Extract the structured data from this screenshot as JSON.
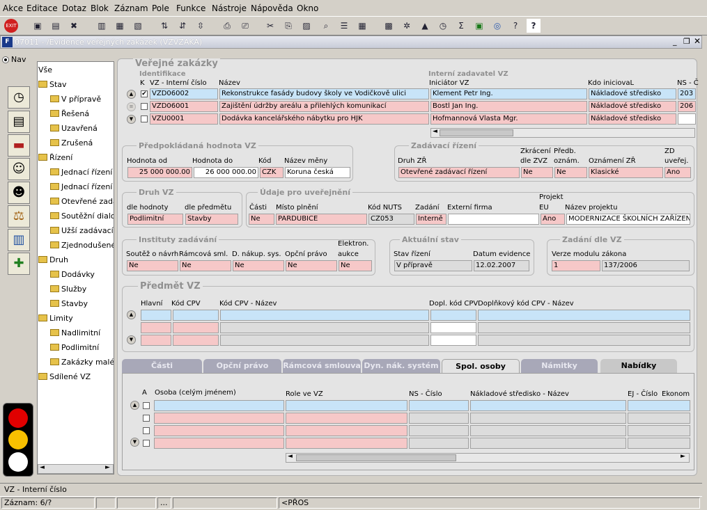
{
  "menu": [
    "Akce",
    "Editace",
    "Dotaz",
    "Blok",
    "Záznam",
    "Pole",
    "Funkce",
    "Nástroje",
    "Nápověda",
    "Okno"
  ],
  "window": {
    "title": "07011 - /Evidence veřejných zakázek (VZVZAKA)"
  },
  "nav": {
    "radio": "Nav"
  },
  "tree": {
    "root": "Vše",
    "items": [
      {
        "l": "Stav",
        "d": 0
      },
      {
        "l": "V přípravě",
        "d": 1
      },
      {
        "l": "Řešená",
        "d": 1
      },
      {
        "l": "Uzavřená",
        "d": 1
      },
      {
        "l": "Zrušená",
        "d": 1
      },
      {
        "l": "Řízení",
        "d": 0
      },
      {
        "l": "Jednací řízení b",
        "d": 1
      },
      {
        "l": "Jednací řízení s",
        "d": 1
      },
      {
        "l": "Otevřené zadá",
        "d": 1
      },
      {
        "l": "Soutěžní dialog",
        "d": 1
      },
      {
        "l": "Užší zadávací í",
        "d": 1
      },
      {
        "l": "Zjednodušené",
        "d": 1
      },
      {
        "l": "Druh",
        "d": 0
      },
      {
        "l": "Dodávky",
        "d": 1
      },
      {
        "l": "Služby",
        "d": 1
      },
      {
        "l": "Stavby",
        "d": 1
      },
      {
        "l": "Limity",
        "d": 0
      },
      {
        "l": "Nadlimitní",
        "d": 1
      },
      {
        "l": "Podlimitní",
        "d": 1
      },
      {
        "l": "Zakázky maléh",
        "d": 1
      },
      {
        "l": "Sdílené VZ",
        "d": 0
      }
    ]
  },
  "vz": {
    "title": "Veřejné zakázky",
    "sub1": "Identifikace",
    "sub2": "Interní zadavatel VZ",
    "hdr": {
      "k": "K",
      "cislo": "VZ - Interní číslo",
      "nazev": "Název",
      "inic": "Iniciátor VZ",
      "kdo": "Kdo iniciovaL",
      "ns": "NS - Č"
    },
    "rows": [
      {
        "checked": "✔",
        "cislo": "VZD06002",
        "nazev": "Rekonstrukce fasády budovy školy ve Vodičkově ulici",
        "inic": "Klement Petr Ing.",
        "kdo": "Nákladové středisko",
        "ns": "203"
      },
      {
        "checked": "",
        "cislo": "VZD06001",
        "nazev": "Zajištění údržby areálu a přilehlých komunikací",
        "inic": "Bostl Jan Ing.",
        "kdo": "Nákladové středisko",
        "ns": "206"
      },
      {
        "checked": "",
        "cislo": "VZU0001",
        "nazev": "Dodávka kancelářského nábytku pro HJK",
        "inic": "Hofmannová Vlasta Mgr.",
        "kdo": "Nákladové středisko",
        "ns": ""
      }
    ]
  },
  "hodnota": {
    "title": "Předpokládaná hodnota VZ",
    "l_od": "Hodnota od",
    "l_do": "Hodnota do",
    "l_kod": "Kód",
    "l_mena": "Název měny",
    "od": "25 000 000.00",
    "do": "26 000 000.00",
    "kod": "CZK",
    "mena": "Koruna česká"
  },
  "zadavaci": {
    "title": "Zadávací řízení",
    "l_druh": "Druh ZŘ",
    "l_zkr1": "Zkrácení",
    "l_zkr2": "dle ZVZ",
    "l_pr1": "Předb.",
    "l_pr2": "oznám.",
    "l_ozn": "Oznámení ZŘ",
    "l_zd1": "ZD",
    "l_zd2": "uveřej.",
    "druh": "Otevřené zadávací řízení",
    "zkr": "Ne",
    "pr": "Ne",
    "ozn": "Klasické",
    "zd": "Ano"
  },
  "druhvz": {
    "title": "Druh VZ",
    "l_h": "dle hodnoty",
    "l_p": "dle předmětu",
    "h": "Podlimitní",
    "p": "Stavby"
  },
  "udaje": {
    "title": "Údaje pro uveřejnění",
    "l_casti": "Části",
    "l_misto": "Místo plnění",
    "l_nuts": "Kód NUTS",
    "l_zad": "Zadání",
    "l_firma": "Externí firma",
    "l_proj1": "Projekt",
    "l_proj2": "EU",
    "l_nproj": "Název projektu",
    "casti": "Ne",
    "misto": "PARDUBICE",
    "nuts": "CZ053",
    "zad": "Interně",
    "firma": "",
    "proj": "Ano",
    "nproj": "MODERNIZACE ŠKOLNÍCH ZAŘÍZENÍ"
  },
  "instituty": {
    "title": "Instituty zadávání",
    "l1": "Soutěž o návrh",
    "l2": "Rámcová sml.",
    "l3": "D. nákup. sys.",
    "l4": "Opční právo",
    "l5a": "Elektron.",
    "l5b": "aukce",
    "v": [
      "Ne",
      "Ne",
      "Ne",
      "Ne",
      "Ne"
    ]
  },
  "aktualni": {
    "title": "Aktuální stav",
    "l_stav": "Stav řízení",
    "l_dat": "Datum evidence",
    "stav": "V přípravě",
    "dat": "12.02.2007"
  },
  "zadani": {
    "title": "Zadání dle VZ",
    "l_ver": "Verze modulu",
    "l_zak": "zákona",
    "ver": "1",
    "zak": "137/2006"
  },
  "predmet": {
    "title": "Předmět VZ",
    "h1": "Hlavní",
    "h2": "Kód CPV",
    "h3": "Kód CPV - Název",
    "h4": "Dopl. kód CPV",
    "h5": "Doplňkový kód CPV - Název"
  },
  "tabs": [
    "Části",
    "Opční právo",
    "Rámcová smlouva",
    "Dyn. nák. systém",
    "Spol. osoby",
    "Námitky",
    "Nabídky"
  ],
  "osoby": {
    "h_a": "A",
    "h_osoba": "Osoba (celým jménem)",
    "h_role": "Role ve VZ",
    "h_ns": "NS - Číslo",
    "h_nsn": "Nákladové středisko - Název",
    "h_ej": "EJ - Číslo",
    "h_ek": "Ekonom"
  },
  "status": {
    "field": "VZ - Interní číslo",
    "zaznam": "Záznam: 6/?",
    "dots": "...",
    "pros": "<PŘOS"
  }
}
